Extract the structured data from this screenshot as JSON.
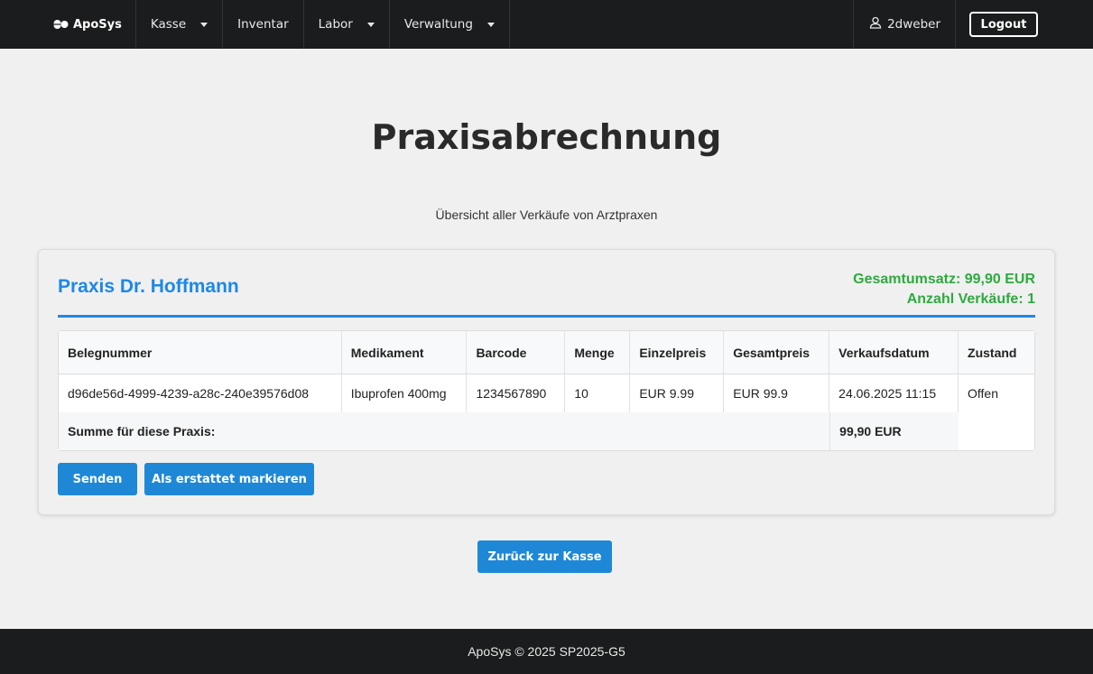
{
  "nav": {
    "brand": "ApoSys",
    "items": [
      {
        "label": "Kasse",
        "dropdown": true
      },
      {
        "label": "Inventar",
        "dropdown": false
      },
      {
        "label": "Labor",
        "dropdown": true
      },
      {
        "label": "Verwaltung",
        "dropdown": true
      }
    ],
    "user": "2dweber",
    "logout": "Logout"
  },
  "page": {
    "title": "Praxisabrechnung",
    "subtitle": "Übersicht aller Verkäufe von Arztpraxen"
  },
  "praxis": {
    "name": "Praxis Dr. Hoffmann",
    "total_revenue": "Gesamtumsatz: 99,90 EUR",
    "sales_count": "Anzahl Verkäufe: 1",
    "columns": [
      "Belegnummer",
      "Medikament",
      "Barcode",
      "Menge",
      "Einzelpreis",
      "Gesamtpreis",
      "Verkaufsdatum",
      "Zustand"
    ],
    "rows": [
      [
        "d96de56d-4999-4239-a28c-240e39576d08",
        "Ibuprofen 400mg",
        "1234567890",
        "10",
        "EUR 9.99",
        "EUR 99.9",
        "24.06.2025 11:15",
        "Offen"
      ]
    ],
    "sum_label": "Summe für diese Praxis:",
    "sum_value": "99,90 EUR",
    "send_button": "Senden",
    "refund_button": "Als erstattet markieren"
  },
  "back_button": "Zurück zur Kasse",
  "footer": "ApoSys © 2025 SP2025-G5",
  "colors": {
    "accent": "#1e88e5",
    "button": "#1e88d6",
    "success": "#2eaa3f",
    "navbar": "#1b1c1d"
  }
}
